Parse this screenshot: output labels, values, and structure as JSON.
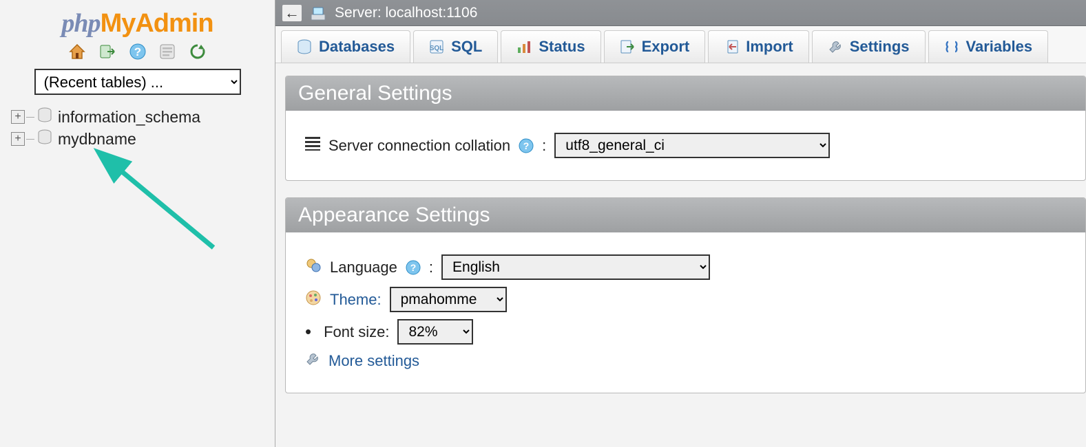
{
  "sidebar": {
    "logo": {
      "part1": "php",
      "part2": "My",
      "part3": "Admin"
    },
    "recent_tables_placeholder": "(Recent tables) ...",
    "databases": [
      {
        "name": "information_schema"
      },
      {
        "name": "mydbname"
      }
    ]
  },
  "serverbar": {
    "label": "Server: localhost:1106"
  },
  "tabs": {
    "databases": "Databases",
    "sql": "SQL",
    "status": "Status",
    "export": "Export",
    "import": "Import",
    "settings": "Settings",
    "variables": "Variables"
  },
  "general": {
    "title": "General Settings",
    "collation_label": "Server connection collation",
    "collation_value": "utf8_general_ci"
  },
  "appearance": {
    "title": "Appearance Settings",
    "language_label": "Language",
    "language_value": "English",
    "theme_label": "Theme:",
    "theme_value": "pmahomme",
    "fontsize_label": "Font size:",
    "fontsize_value": "82%",
    "more_settings": "More settings"
  }
}
